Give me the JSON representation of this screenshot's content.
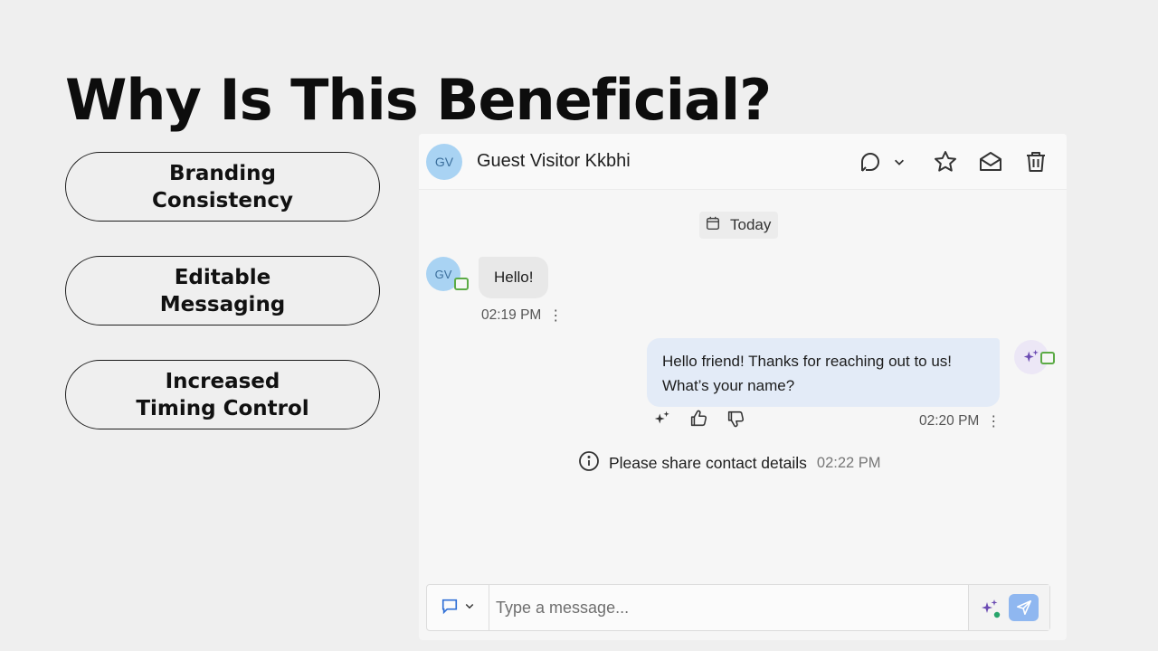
{
  "slide": {
    "title": "Why Is This Beneficial?",
    "benefits": [
      {
        "line1": "Branding",
        "line2": "Consistency"
      },
      {
        "line1": "Editable",
        "line2": "Messaging"
      },
      {
        "line1": "Increased",
        "line2": "Timing Control"
      }
    ]
  },
  "chat": {
    "header": {
      "avatar_initials": "GV",
      "name": "Guest Visitor Kkbhi",
      "icons": [
        "chat-bubble-icon",
        "chevron-down-icon",
        "star-icon",
        "envelope-open-icon",
        "trash-icon"
      ]
    },
    "date_label": "Today",
    "messages": [
      {
        "sender_initials": "GV",
        "text": "Hello!",
        "time": "02:19 PM"
      },
      {
        "text_line1": "Hello friend! Thanks for reaching out to us!",
        "text_line2": "What’s your name?",
        "time": "02:20 PM"
      }
    ],
    "system_note": {
      "text": "Please share contact details",
      "time": "02:22 PM"
    },
    "composer": {
      "placeholder": "Type a message..."
    },
    "colors": {
      "avatar": "#a9d3f3",
      "outgoing_bubble": "#e3ebf7",
      "send_button": "#8fb7f0",
      "badge_green": "#5cab46",
      "sparkle_purple": "#6b4bb3"
    }
  }
}
